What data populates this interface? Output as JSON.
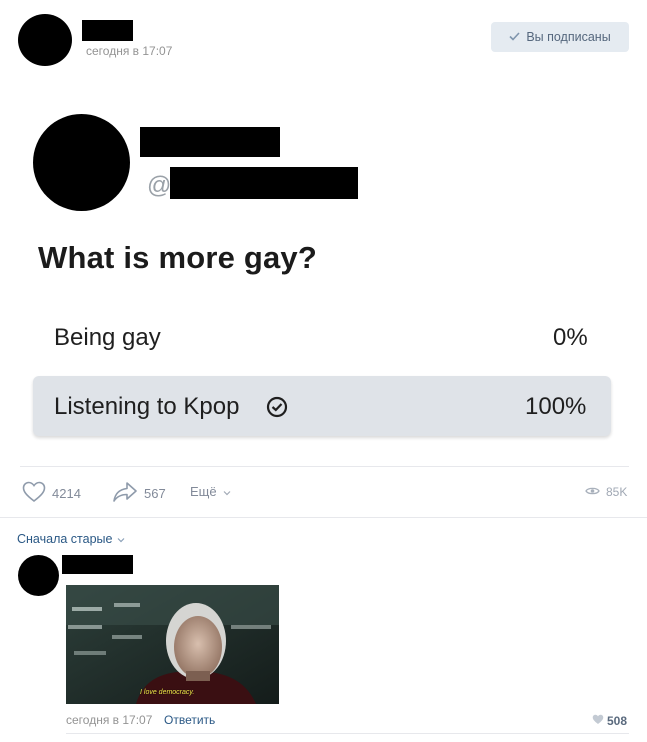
{
  "post": {
    "time": "сегодня в 17:07",
    "subscribe_label": "Вы подписаны",
    "tweet": {
      "handle_prefix": "@",
      "question": "What is more gay?",
      "options": [
        {
          "label": "Being gay",
          "percent": "0%"
        },
        {
          "label": "Listening to Kpop",
          "percent": "100%"
        }
      ]
    },
    "likes": "4214",
    "shares": "567",
    "more_label": "Ещё",
    "views": "85K"
  },
  "comments": {
    "sort_label": "Сначала старые",
    "items": [
      {
        "meme_caption": "I love democracy.",
        "time": "сегодня в 17:07",
        "reply_label": "Ответить",
        "likes": "508"
      }
    ]
  },
  "colors": {
    "accent": "#2a5885",
    "subscribe_bg": "#e5ebf1",
    "muted": "#828a99"
  }
}
